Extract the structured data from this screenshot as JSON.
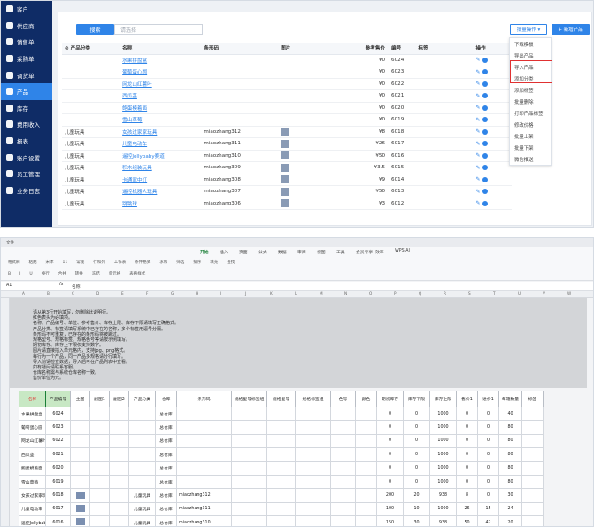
{
  "top": {
    "sidebar": [
      {
        "label": "客户",
        "active": false
      },
      {
        "label": "供应商",
        "active": false
      },
      {
        "label": "销售单",
        "active": false
      },
      {
        "label": "采购单",
        "active": false
      },
      {
        "label": "调货单",
        "active": false
      },
      {
        "label": "产品",
        "active": true
      },
      {
        "label": "库存",
        "active": false
      },
      {
        "label": "费用收入",
        "active": false
      },
      {
        "label": "报表",
        "active": false
      },
      {
        "label": "账户设置",
        "active": false
      },
      {
        "label": "员工管理",
        "active": false
      },
      {
        "label": "业务日志",
        "active": false
      }
    ],
    "toolbar": {
      "search_label": "搜索",
      "search_placeholder": "请选择",
      "batch_label": "批量操作 ▾",
      "add_label": "+ 新增产品"
    },
    "table": {
      "headers": [
        "⊙ 产品分类",
        "名称",
        "条形码",
        "图片",
        "参考售价",
        "编号",
        "标签",
        "操作"
      ],
      "rows": [
        {
          "category": "",
          "name": "水果拼盘盒",
          "barcode": "",
          "image": false,
          "price": "¥0",
          "code": "6024"
        },
        {
          "category": "",
          "name": "葡萄蛋心圆",
          "barcode": "",
          "image": false,
          "price": "¥0",
          "code": "6023"
        },
        {
          "category": "",
          "name": "网龙山红薯叶",
          "barcode": "",
          "image": false,
          "price": "¥0",
          "code": "6022"
        },
        {
          "category": "",
          "name": "西瓜茎",
          "barcode": "",
          "image": false,
          "price": "¥0",
          "code": "6021"
        },
        {
          "category": "",
          "name": "鲍蛋模着面",
          "barcode": "",
          "image": false,
          "price": "¥0",
          "code": "6020"
        },
        {
          "category": "",
          "name": "雪山草莓",
          "barcode": "",
          "image": false,
          "price": "¥0",
          "code": "6019"
        },
        {
          "category": "儿童玩具",
          "name": "女孩过家家玩具",
          "barcode": "miaozhang312",
          "image": true,
          "price": "¥8",
          "code": "6018"
        },
        {
          "category": "儿童玩具",
          "name": "儿童电动车",
          "barcode": "miaozhang311",
          "image": true,
          "price": "¥26",
          "code": "6017"
        },
        {
          "category": "儿童玩具",
          "name": "遥控Jollybaby赛道",
          "barcode": "miaozhang310",
          "image": true,
          "price": "¥50",
          "code": "6016"
        },
        {
          "category": "儿童玩具",
          "name": "积木组装玩具",
          "barcode": "miaozhang309",
          "image": true,
          "price": "¥3.5",
          "code": "6015"
        },
        {
          "category": "儿童玩具",
          "name": "卡通家中灯",
          "barcode": "miaozhang308",
          "image": true,
          "price": "¥9",
          "code": "6014"
        },
        {
          "category": "儿童玩具",
          "name": "遥控机器人玩具",
          "barcode": "miaozhang307",
          "image": true,
          "price": "¥50",
          "code": "6013"
        },
        {
          "category": "儿童玩具",
          "name": "跳跳球",
          "barcode": "miaozhang306",
          "image": true,
          "price": "¥3",
          "code": "6012"
        }
      ]
    },
    "dropdown": [
      "下载模板",
      "导出产品",
      "导入产品",
      "添加分类",
      "添加标签",
      "批量删除",
      "打印产品标签",
      "修改价格",
      "批量上架",
      "批量下架",
      "微信推送"
    ]
  },
  "bottom": {
    "titlebar": "文件",
    "ribbon_tabs": [
      "开始",
      "插入",
      "页面",
      "公式",
      "数据",
      "审阅",
      "视图",
      "工具",
      "会员专享",
      "效率",
      "WPS AI"
    ],
    "active_ribbon_tab": "开始",
    "ribbon_row1": [
      "格式刷",
      "粘贴",
      "宋体",
      "11",
      "常规",
      "行和列",
      "工作表",
      "条件格式",
      "求和",
      "筛选",
      "排序",
      "填充",
      "查找"
    ],
    "ribbon_row2": [
      "B",
      "I",
      "U",
      "换行",
      "合并",
      "转换",
      "冻结",
      "单元格",
      "表格样式"
    ],
    "cell_ref": "A1",
    "formula_value": "名称",
    "col_letters": [
      "A",
      "B",
      "C",
      "D",
      "E",
      "F",
      "G",
      "H",
      "I",
      "J",
      "K",
      "L",
      "M",
      "N",
      "O",
      "P",
      "Q",
      "R",
      "S",
      "T",
      "U",
      "V",
      "W"
    ],
    "notes": [
      "请从第3行开始填写，勿删除此说明行。",
      "红色表头为必填项。",
      "名称、产品编号、单位、参考售价、库存上限、库存下限请填写正确格式。",
      "产品分类、标签请填写系统中已存在的名称，多个标签用逗号分隔。",
      "条形码不可重复，已存在的条形码将被跳过。",
      "规格型号、规格标签、规格色号等请按示例填写。",
      "期初库存、库存上下限仅支持数字。",
      "图片请直接插入单元格内，支持jpg、png格式。",
      "每行为一个产品，同一产品多规格请分行填写。",
      "导入前请检查数据，导入后可在产品列表中查看。",
      "如有疑问请联系客服。",
      "仓库名称需与系统仓库名称一致。",
      "售价单位为元。"
    ],
    "sheet_headers": [
      "名称",
      "产品编号",
      "主图",
      "副图1",
      "副图2",
      "产品分类",
      "仓库",
      "条形码",
      "规格型号标签组",
      "规格型号",
      "规格标签组",
      "色号",
      "颜色",
      "期初库存",
      "库存下限",
      "库存上限",
      "售价1",
      "进价1",
      "每箱数量",
      "标签"
    ],
    "sheet_rows": [
      {
        "name": "水果拼盘盒",
        "code": "6024",
        "img": false,
        "category": "",
        "warehouse": "总仓库",
        "barcode": "",
        "stock": "0",
        "low": "0",
        "high": "1000",
        "p1": "0",
        "c1": "0",
        "box": "40"
      },
      {
        "name": "葡萄蛋心圆",
        "code": "6023",
        "img": false,
        "category": "",
        "warehouse": "总仓库",
        "barcode": "",
        "stock": "0",
        "low": "0",
        "high": "1000",
        "p1": "0",
        "c1": "0",
        "box": "80"
      },
      {
        "name": "网龙山红薯叶",
        "code": "6022",
        "img": false,
        "category": "",
        "warehouse": "总仓库",
        "barcode": "",
        "stock": "0",
        "low": "0",
        "high": "1000",
        "p1": "0",
        "c1": "0",
        "box": "80"
      },
      {
        "name": "西瓜茎",
        "code": "6021",
        "img": false,
        "category": "",
        "warehouse": "总仓库",
        "barcode": "",
        "stock": "0",
        "low": "0",
        "high": "1000",
        "p1": "0",
        "c1": "0",
        "box": "80"
      },
      {
        "name": "鲍蛋模着面",
        "code": "6020",
        "img": false,
        "category": "",
        "warehouse": "总仓库",
        "barcode": "",
        "stock": "0",
        "low": "0",
        "high": "1000",
        "p1": "0",
        "c1": "0",
        "box": "80"
      },
      {
        "name": "雪山草莓",
        "code": "6019",
        "img": false,
        "category": "",
        "warehouse": "总仓库",
        "barcode": "",
        "stock": "0",
        "low": "0",
        "high": "1000",
        "p1": "0",
        "c1": "0",
        "box": "80"
      },
      {
        "name": "女孩过家家玩具",
        "code": "6018",
        "img": true,
        "category": "儿童玩具",
        "warehouse": "总仓库",
        "barcode": "miaozhang312",
        "stock": "200",
        "low": "20",
        "high": "938",
        "p1": "8",
        "c1": "0",
        "box": "30"
      },
      {
        "name": "儿童电动车",
        "code": "6017",
        "img": true,
        "category": "儿童玩具",
        "warehouse": "总仓库",
        "barcode": "miaozhang311",
        "stock": "100",
        "low": "10",
        "high": "1000",
        "p1": "26",
        "c1": "15",
        "box": "24"
      },
      {
        "name": "遥控Jollybaby赛道",
        "code": "6016",
        "img": true,
        "category": "儿童玩具",
        "warehouse": "总仓库",
        "barcode": "miaozhang310",
        "stock": "150",
        "low": "30",
        "high": "938",
        "p1": "50",
        "c1": "42",
        "box": "20"
      }
    ],
    "colors": {
      "header_green": "#c8e8c4",
      "required_red": "#e03131",
      "select_green": "#1a7f37"
    }
  }
}
